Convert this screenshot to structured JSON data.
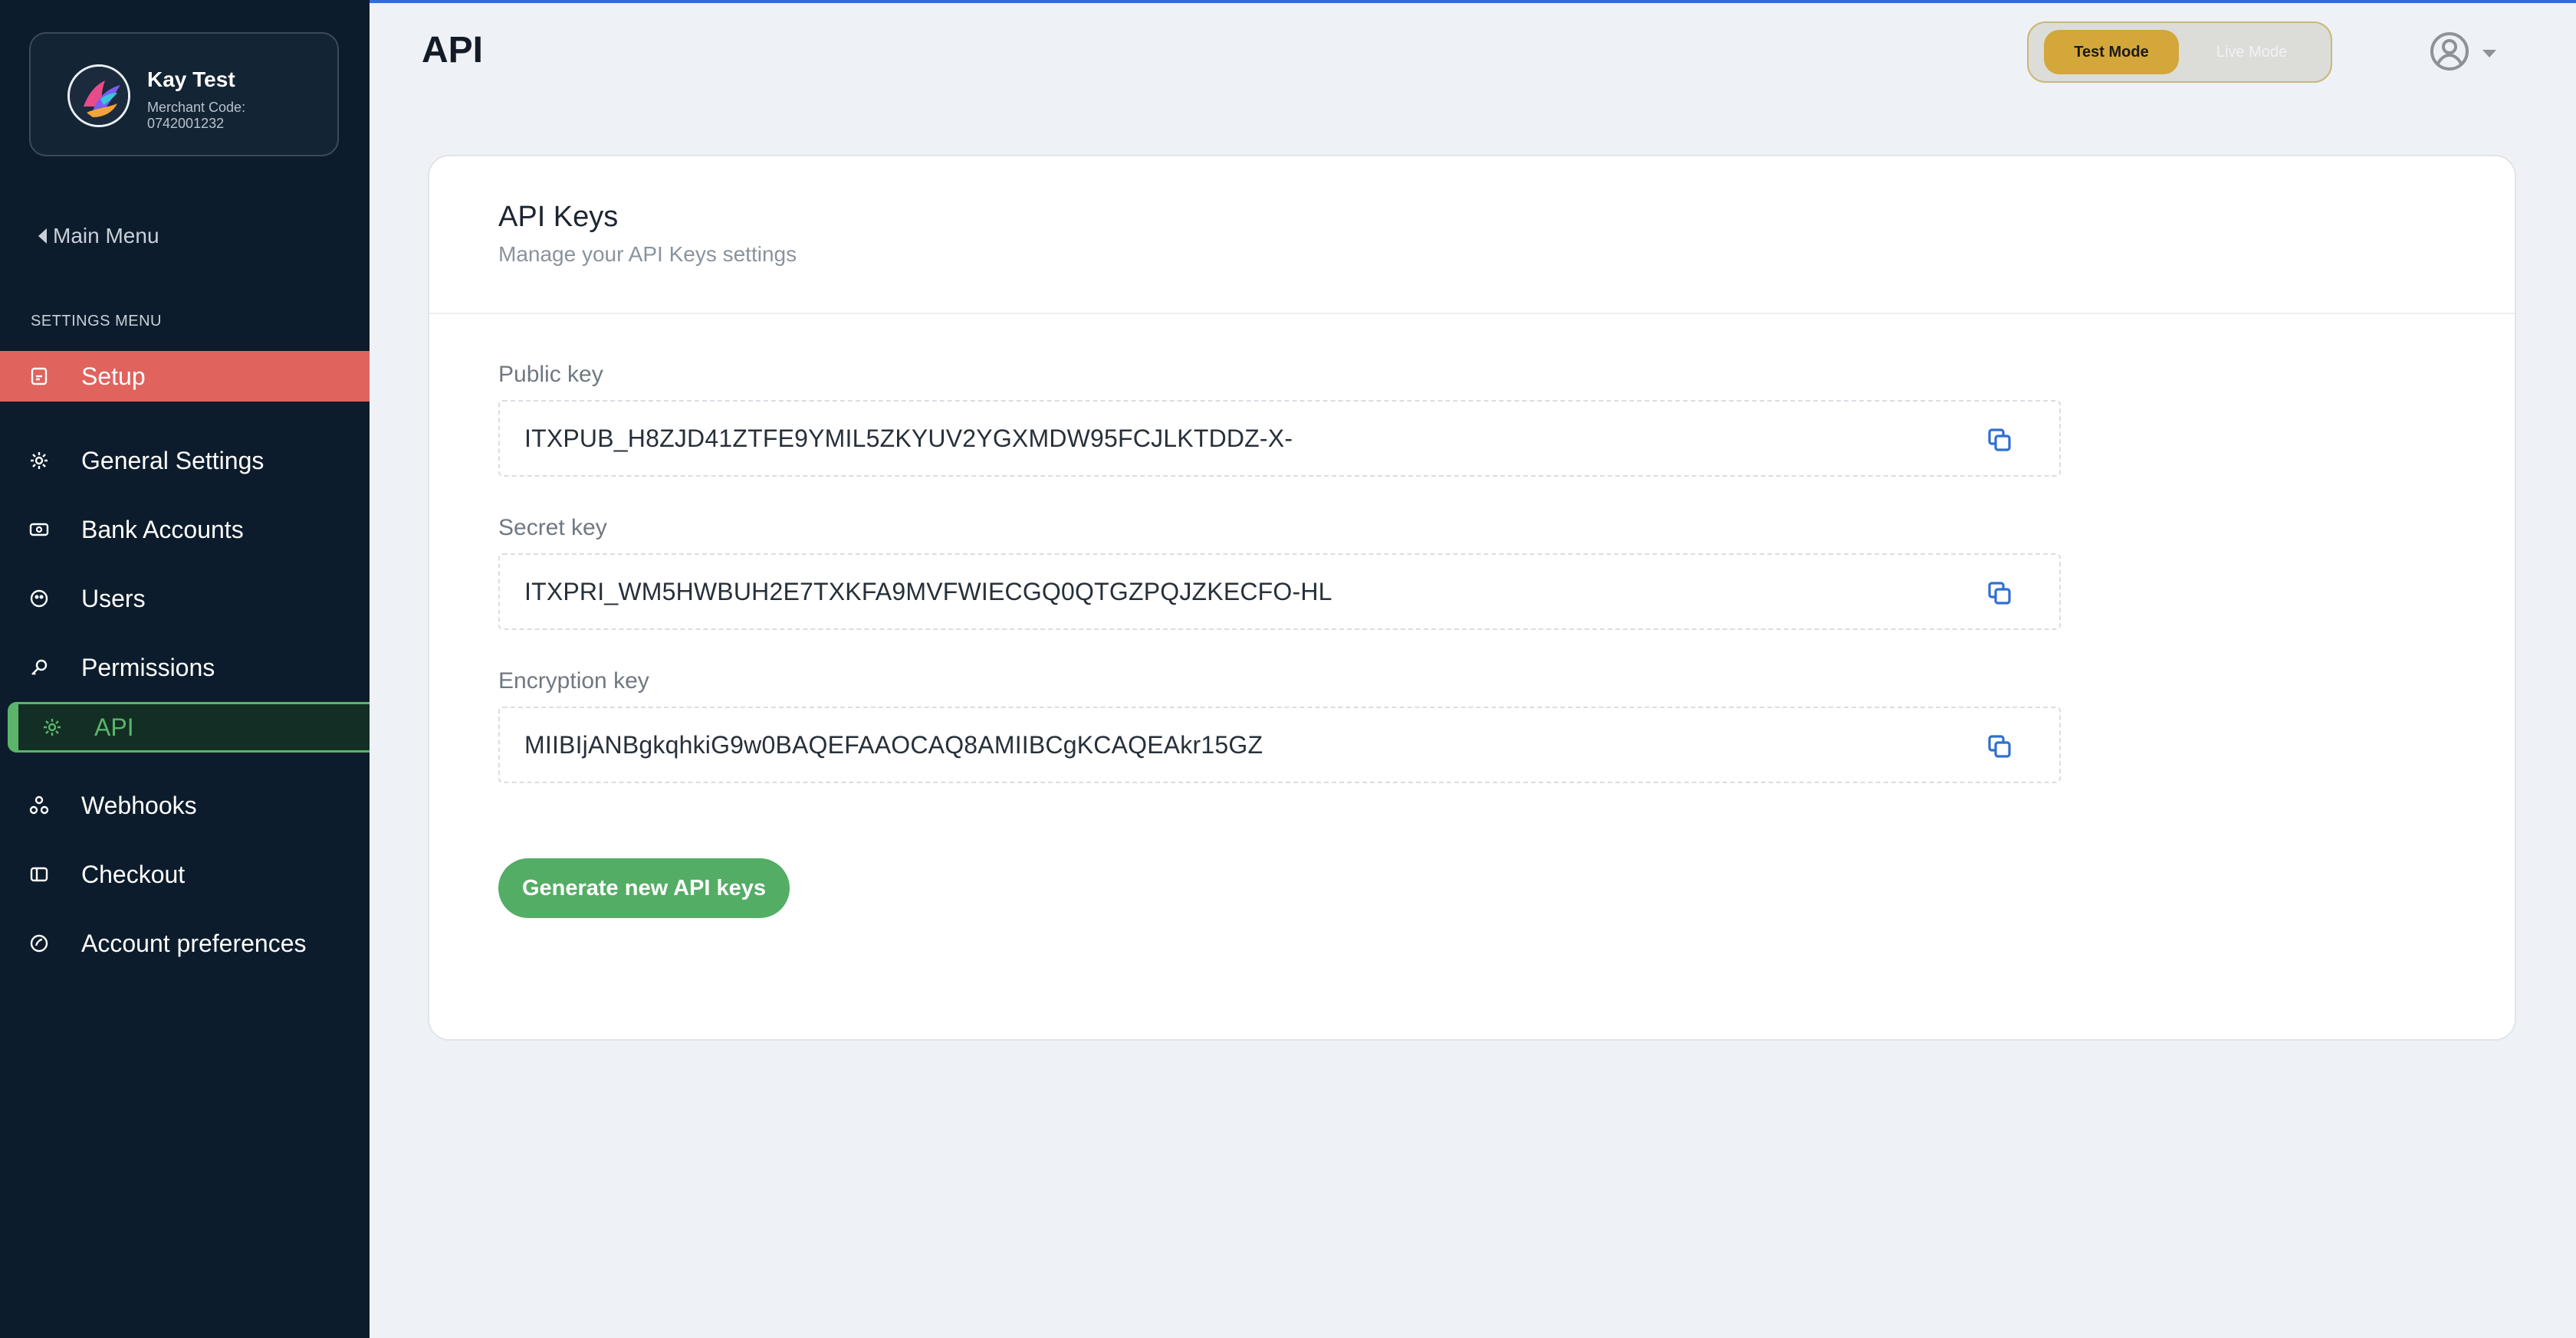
{
  "merchant": {
    "name": "Kay Test",
    "code_label": "Merchant Code:",
    "code": "0742001232"
  },
  "nav": {
    "back_label": "Main Menu",
    "section_heading": "SETTINGS MENU",
    "items": [
      {
        "label": "Setup",
        "icon": "setup-icon"
      },
      {
        "label": "General Settings",
        "icon": "gear-icon"
      },
      {
        "label": "Bank Accounts",
        "icon": "bank-icon"
      },
      {
        "label": "Users",
        "icon": "users-icon"
      },
      {
        "label": "Permissions",
        "icon": "key-icon"
      },
      {
        "label": "API",
        "icon": "gear-icon",
        "active": true
      },
      {
        "label": "Webhooks",
        "icon": "webhooks-icon"
      },
      {
        "label": "Checkout",
        "icon": "checkout-icon"
      },
      {
        "label": "Account preferences",
        "icon": "preferences-icon"
      }
    ]
  },
  "header": {
    "title": "API",
    "mode": {
      "test_label": "Test Mode",
      "live_label": "Live Mode",
      "selected": "Test Mode"
    }
  },
  "card": {
    "title": "API Keys",
    "subtitle": "Manage your API Keys settings",
    "keys": [
      {
        "label": "Public key",
        "value": "ITXPUB_H8ZJD41ZTFE9YMIL5ZKYUV2YGXMDW95FCJLKTDDZ-X-"
      },
      {
        "label": "Secret key",
        "value": "ITXPRI_WM5HWBUH2E7TXKFA9MVFWIECGQ0QTGZPQJZKECFO-HL"
      },
      {
        "label": "Encryption key",
        "value": "MIIBIjANBgkqhkiG9w0BAQEFAAOCAQ8AMIIBCgKCAQEAkr15GZ"
      }
    ],
    "generate_label": "Generate new API keys"
  },
  "colors": {
    "sidebar_bg": "#0c1c2c",
    "setup_highlight": "#e0635e",
    "active_green": "#5ab56a",
    "test_mode_gold": "#d4a73b",
    "copy_icon_blue": "#2f6fd0",
    "generate_button": "#53ad64"
  }
}
